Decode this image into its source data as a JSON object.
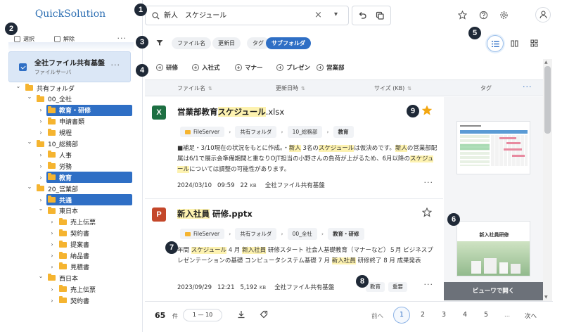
{
  "app": {
    "title": "QuickSolution"
  },
  "selection_bar": {
    "select_label": "選択",
    "deselect_label": "解除",
    "more": "···"
  },
  "source": {
    "name": "全社ファイル共有基盤",
    "sub": "ファイルサーバ",
    "more": "···"
  },
  "tree": [
    {
      "label": "共有フォルダ",
      "level": 0,
      "expanded": true,
      "selected": false
    },
    {
      "label": "00_全社",
      "level": 1,
      "expanded": true,
      "selected": false
    },
    {
      "label": "教育・研修",
      "level": 2,
      "expanded": false,
      "selected": true
    },
    {
      "label": "申請書類",
      "level": 2,
      "expanded": false,
      "selected": false
    },
    {
      "label": "規程",
      "level": 2,
      "expanded": false,
      "selected": false
    },
    {
      "label": "10_総務部",
      "level": 1,
      "expanded": true,
      "selected": false
    },
    {
      "label": "人事",
      "level": 2,
      "expanded": false,
      "selected": false
    },
    {
      "label": "労務",
      "level": 2,
      "expanded": false,
      "selected": false
    },
    {
      "label": "教育",
      "level": 2,
      "expanded": false,
      "selected": true
    },
    {
      "label": "20_営業部",
      "level": 1,
      "expanded": true,
      "selected": false
    },
    {
      "label": "共通",
      "level": 2,
      "expanded": false,
      "selected": true
    },
    {
      "label": "東日本",
      "level": 2,
      "expanded": true,
      "selected": false
    },
    {
      "label": "売上伝票",
      "level": 3,
      "expanded": false,
      "selected": false
    },
    {
      "label": "契約書",
      "level": 3,
      "expanded": false,
      "selected": false
    },
    {
      "label": "提案書",
      "level": 3,
      "expanded": false,
      "selected": false
    },
    {
      "label": "納品書",
      "level": 3,
      "expanded": false,
      "selected": false
    },
    {
      "label": "見積書",
      "level": 3,
      "expanded": false,
      "selected": false
    },
    {
      "label": "西日本",
      "level": 2,
      "expanded": true,
      "selected": false
    },
    {
      "label": "売上伝票",
      "level": 3,
      "expanded": false,
      "selected": false
    },
    {
      "label": "契約書",
      "level": 3,
      "expanded": false,
      "selected": false
    }
  ],
  "search": {
    "value": "新人　スケジュール",
    "clear": "×",
    "dropdown": "▾"
  },
  "filters": [
    {
      "label": "ファイル名",
      "active": false
    },
    {
      "label": "更新日",
      "active": false
    },
    {
      "label": "タグ",
      "active": false
    },
    {
      "label": "サブフォルダ",
      "active": true
    }
  ],
  "tag_buttons": [
    "研修",
    "入社式",
    "マナー",
    "プレゼン",
    "営業部"
  ],
  "table_header": {
    "filename": "ファイル名",
    "updated": "更新日時",
    "size": "サイズ (KB)",
    "tag": "タグ",
    "more": "···"
  },
  "results": [
    {
      "badge": "X",
      "badge_color": "#1d6f42",
      "name_prefix": "営業部教育",
      "name_hl": "スケジュール",
      "name_ext": ".xlsx",
      "starred": true,
      "crumbs": [
        "FileServer",
        "共有フォルダ",
        "10_総務部",
        "教育"
      ],
      "snippet_parts": [
        {
          "t": "■補足・3/10現在の状況をもとに作成。・",
          "h": false
        },
        {
          "t": "新人",
          "h": true
        },
        {
          "t": " 3名の",
          "h": false
        },
        {
          "t": "スケジュール",
          "h": true
        },
        {
          "t": "は仮決めです。",
          "h": false
        },
        {
          "t": "新人",
          "h": true
        },
        {
          "t": "の営業部配属は6/1で展示会準備期間と重なりOJT担当の小野さんの負荷が上がるため、6月以降の",
          "h": false
        },
        {
          "t": "スケジュール",
          "h": true
        },
        {
          "t": "については調整の可能性があります。",
          "h": false
        }
      ],
      "date": "2024/03/10",
      "time": "09:59",
      "size": "22",
      "size_unit": "KB",
      "source": "全社ファイル共有基盤",
      "tags": [],
      "more": "···"
    },
    {
      "badge": "P",
      "badge_color": "#c4472a",
      "name_prefix": "",
      "name_hl": "新入社員",
      "name_ext": " 研修.pptx",
      "starred": false,
      "crumbs": [
        "FileServer",
        "共有フォルダ",
        "00_全社",
        "教育・研修"
      ],
      "snippet_parts": [
        {
          "t": "年間 ",
          "h": false
        },
        {
          "t": "スケジュール",
          "h": true
        },
        {
          "t": " 4 月 ",
          "h": false
        },
        {
          "t": "新入社員",
          "h": true
        },
        {
          "t": " 研修スタート 社会人基礎教育（マナーなど）５月 ビジネスプレゼンテーションの基礎 コンピュータシステム基礎 7 月 ",
          "h": false
        },
        {
          "t": "新入社員",
          "h": true
        },
        {
          "t": " 研修終了 8 月 成果発表",
          "h": false
        }
      ],
      "date": "2023/09/29",
      "time": "12:21",
      "size": "5,192",
      "size_unit": "KB",
      "source": "全社ファイル共有基盤",
      "tags": [
        "教育",
        "重要"
      ],
      "more": "···"
    }
  ],
  "thumb2_title": "新入社員研修",
  "open_viewer": "ビューワで開く",
  "footer": {
    "count": "65",
    "count_unit": "件",
    "range": "1 — 10",
    "prev": "前へ",
    "next": "次へ",
    "pages": [
      "1",
      "2",
      "3",
      "4",
      "5"
    ],
    "ellipsis": "...",
    "current_page": "1"
  },
  "markers": [
    "1",
    "2",
    "3",
    "4",
    "5",
    "6",
    "7",
    "8",
    "9"
  ],
  "colors": {
    "accent": "#2f6fc5",
    "folder": "#f5b430",
    "highlight": "#fdf2b0",
    "marker": "#1f2937"
  }
}
